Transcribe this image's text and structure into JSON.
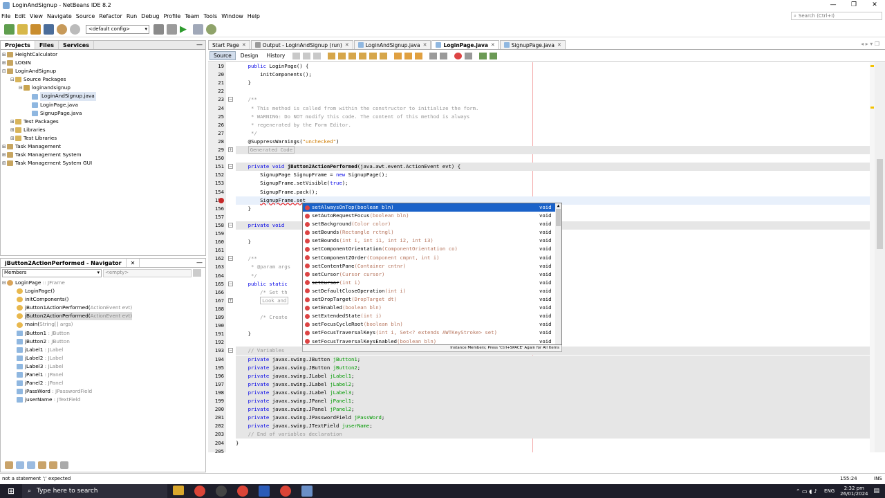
{
  "window": {
    "title": "LoginAndSignup - NetBeans IDE 8.2",
    "controls": [
      "—",
      "❐",
      "✕"
    ]
  },
  "menu": [
    "File",
    "Edit",
    "View",
    "Navigate",
    "Source",
    "Refactor",
    "Run",
    "Debug",
    "Profile",
    "Team",
    "Tools",
    "Window",
    "Help"
  ],
  "search": {
    "placeholder": "Search (Ctrl+I)"
  },
  "toolbar": {
    "config": "<default config>"
  },
  "projects_panel": {
    "tabs": [
      "Projects",
      "Files",
      "Services"
    ],
    "tree": [
      {
        "label": "HeightCalculator",
        "level": 0,
        "exp": "⊞",
        "icon": "project"
      },
      {
        "label": "LOGIN",
        "level": 0,
        "exp": "⊞",
        "icon": "project"
      },
      {
        "label": "LoginAndSignup",
        "level": 0,
        "exp": "⊟",
        "icon": "project"
      },
      {
        "label": "Source Packages",
        "level": 1,
        "exp": "⊟",
        "icon": "folder"
      },
      {
        "label": "loginandsignup",
        "level": 2,
        "exp": "⊟",
        "icon": "package"
      },
      {
        "label": "LoginAndSignup.java",
        "level": 3,
        "exp": "",
        "icon": "java",
        "selected": true
      },
      {
        "label": "LoginPage.java",
        "level": 3,
        "exp": "",
        "icon": "java"
      },
      {
        "label": "SignupPage.java",
        "level": 3,
        "exp": "",
        "icon": "java"
      },
      {
        "label": "Test Packages",
        "level": 1,
        "exp": "⊞",
        "icon": "folder"
      },
      {
        "label": "Libraries",
        "level": 1,
        "exp": "⊞",
        "icon": "folder"
      },
      {
        "label": "Test Libraries",
        "level": 1,
        "exp": "⊞",
        "icon": "folder"
      },
      {
        "label": "Task Management",
        "level": 0,
        "exp": "⊞",
        "icon": "project"
      },
      {
        "label": "Task Management System",
        "level": 0,
        "exp": "⊞",
        "icon": "project"
      },
      {
        "label": "Task Management System GUI",
        "level": 0,
        "exp": "⊞",
        "icon": "project"
      }
    ]
  },
  "navigator": {
    "title": "jButton2ActionPerformed - Navigator",
    "filter": "Members",
    "empty": "<empty>",
    "items": [
      {
        "name": "LoginPage",
        "type": " :: JFrame",
        "level": 0,
        "icon": "class"
      },
      {
        "name": "LoginPage()",
        "type": "",
        "level": 1,
        "icon": "ctor"
      },
      {
        "name": "initComponents()",
        "type": "",
        "level": 1,
        "icon": "method"
      },
      {
        "name": "jButton1ActionPerformed(",
        "type": "ActionEvent evt)",
        "level": 1,
        "icon": "method"
      },
      {
        "name": "jButton2ActionPerformed(",
        "type": "ActionEvent evt)",
        "level": 1,
        "icon": "method",
        "selected": true
      },
      {
        "name": "main(",
        "type": "String[] args)",
        "level": 1,
        "icon": "method"
      },
      {
        "name": "jButton1",
        "type": " : JButton",
        "level": 1,
        "icon": "field"
      },
      {
        "name": "jButton2",
        "type": " : JButton",
        "level": 1,
        "icon": "field"
      },
      {
        "name": "jLabel1",
        "type": " : JLabel",
        "level": 1,
        "icon": "field"
      },
      {
        "name": "jLabel2",
        "type": " : JLabel",
        "level": 1,
        "icon": "field"
      },
      {
        "name": "jLabel3",
        "type": " : JLabel",
        "level": 1,
        "icon": "field"
      },
      {
        "name": "jPanel1",
        "type": " : JPanel",
        "level": 1,
        "icon": "field"
      },
      {
        "name": "jPanel2",
        "type": " : JPanel",
        "level": 1,
        "icon": "field"
      },
      {
        "name": "jPassWord",
        "type": " : JPasswordField",
        "level": 1,
        "icon": "field"
      },
      {
        "name": "juserName",
        "type": " : JTextField",
        "level": 1,
        "icon": "field"
      }
    ]
  },
  "editor_tabs": [
    {
      "label": "Start Page",
      "active": false
    },
    {
      "label": "Output - LoginAndSignup (run)",
      "active": false
    },
    {
      "label": "LoginAndSignup.java",
      "active": false
    },
    {
      "label": "LoginPage.java",
      "active": true
    },
    {
      "label": "SignupPage.java",
      "active": false
    }
  ],
  "source_tabs": [
    "Source",
    "Design",
    "History"
  ],
  "code_lines": [
    {
      "n": "19",
      "html": "    <span class='kw'>public</span> LoginPage() {"
    },
    {
      "n": "20",
      "html": "        initComponents();"
    },
    {
      "n": "21",
      "html": "    }"
    },
    {
      "n": "22",
      "html": ""
    },
    {
      "n": "23",
      "html": "    <span class='cmt'>/**</span>"
    },
    {
      "n": "24",
      "html": "<span class='cmt'>     * This method is called from within the constructor to initialize the form.</span>"
    },
    {
      "n": "25",
      "html": "<span class='cmt'>     * WARNING: Do NOT modify this code. The content of this method is always</span>"
    },
    {
      "n": "26",
      "html": "<span class='cmt'>     * regenerated by the Form Editor.</span>"
    },
    {
      "n": "27",
      "html": "<span class='cmt'>     */</span>"
    },
    {
      "n": "28",
      "html": "    @SuppressWarnings(<span class='str'>\"unchecked\"</span>)"
    },
    {
      "n": "29",
      "html": "    <span class='cmt' style='border:1px solid #bbb;padding:0 2px'>Generated Code</span>",
      "shade": true
    },
    {
      "n": "150",
      "html": ""
    },
    {
      "n": "151",
      "html": "    <span class='kw'>private void</span> <span class='fn'>jButton2ActionPerformed</span>(java.awt.event.ActionEvent evt) {",
      "shade": true
    },
    {
      "n": "152",
      "html": "        SignupPage SignupFrame = <span class='kw'>new</span> SignupPage();"
    },
    {
      "n": "153",
      "html": "        SignupFrame.setVisible(<span class='kw'>true</span>);"
    },
    {
      "n": "154",
      "html": "        SignupFrame.pack();"
    },
    {
      "n": "155",
      "html": "        <span style='text-decoration:underline wavy #e00'>SignupFrame.set</span>",
      "hl": true
    },
    {
      "n": "156",
      "html": "    }"
    },
    {
      "n": "157",
      "html": ""
    },
    {
      "n": "158",
      "html": "    <span class='kw'>private void</span> ",
      "shade": true
    },
    {
      "n": "159",
      "html": ""
    },
    {
      "n": "160",
      "html": "    }"
    },
    {
      "n": "161",
      "html": ""
    },
    {
      "n": "162",
      "html": "    <span class='cmt'>/**</span>"
    },
    {
      "n": "163",
      "html": "<span class='cmt'>     * @param args</span>"
    },
    {
      "n": "164",
      "html": "<span class='cmt'>     */</span>"
    },
    {
      "n": "165",
      "html": "    <span class='kw'>public static</span>"
    },
    {
      "n": "166",
      "html": "        <span class='cmt'>/* Set th</span>"
    },
    {
      "n": "167",
      "html": "        <span class='cmt' style='border:1px solid #bbb;padding:0 2px'>Look and</span>"
    },
    {
      "n": "188",
      "html": ""
    },
    {
      "n": "189",
      "html": "        <span class='cmt'>/* Create</span>"
    },
    {
      "n": "190",
      "html": ""
    },
    {
      "n": "191",
      "html": "    }"
    },
    {
      "n": "192",
      "html": ""
    },
    {
      "n": "193",
      "html": "    <span class='cmt'>// Variables</span>",
      "shade": true
    },
    {
      "n": "194",
      "html": "    <span class='kw'>private</span> javax.swing.JButton <span class='var'>jButton1</span>;",
      "shade": true
    },
    {
      "n": "195",
      "html": "    <span class='kw'>private</span> javax.swing.JButton <span class='var'>jButton2</span>;",
      "shade": true
    },
    {
      "n": "196",
      "html": "    <span class='kw'>private</span> javax.swing.JLabel <span class='var'>jLabel1</span>;",
      "shade": true
    },
    {
      "n": "197",
      "html": "    <span class='kw'>private</span> javax.swing.JLabel <span class='var'>jLabel2</span>;",
      "shade": true
    },
    {
      "n": "198",
      "html": "    <span class='kw'>private</span> javax.swing.JLabel <span class='var'>jLabel3</span>;",
      "shade": true
    },
    {
      "n": "199",
      "html": "    <span class='kw'>private</span> javax.swing.JPanel <span class='var'>jPanel1</span>;",
      "shade": true
    },
    {
      "n": "200",
      "html": "    <span class='kw'>private</span> javax.swing.JPanel <span class='var'>jPanel2</span>;",
      "shade": true
    },
    {
      "n": "201",
      "html": "    <span class='kw'>private</span> javax.swing.JPasswordField <span class='var'>jPassWord</span>;",
      "shade": true
    },
    {
      "n": "202",
      "html": "    <span class='kw'>private</span> javax.swing.JTextField <span class='var'>juserName</span>;",
      "shade": true
    },
    {
      "n": "203",
      "html": "    <span class='cmt'>// End of variables declaration</span>",
      "shade": true
    },
    {
      "n": "204",
      "html": "}"
    },
    {
      "n": "205",
      "html": ""
    }
  ],
  "completion": {
    "items": [
      {
        "name": "setAlwaysOnTop",
        "params": "(boolean bln)",
        "ret": "void",
        "selected": true
      },
      {
        "name": "setAutoRequestFocus",
        "params": "(boolean bln)",
        "ret": "void"
      },
      {
        "name": "setBackground",
        "params": "(Color color)",
        "ret": "void"
      },
      {
        "name": "setBounds",
        "params": "(Rectangle rctngl)",
        "ret": "void"
      },
      {
        "name": "setBounds",
        "params": "(int i, int i1, int i2, int i3)",
        "ret": "void"
      },
      {
        "name": "setComponentOrientation",
        "params": "(ComponentOrientation co)",
        "ret": "void"
      },
      {
        "name": "setComponentZOrder",
        "params": "(Component cmpnt, int i)",
        "ret": "void"
      },
      {
        "name": "setContentPane",
        "params": "(Container cntnr)",
        "ret": "void"
      },
      {
        "name": "setCursor",
        "params": "(Cursor cursor)",
        "ret": "void"
      },
      {
        "name": "setCursor",
        "params": "(int i)",
        "ret": "void",
        "strike": true
      },
      {
        "name": "setDefaultCloseOperation",
        "params": "(int i)",
        "ret": "void"
      },
      {
        "name": "setDropTarget",
        "params": "(DropTarget dt)",
        "ret": "void"
      },
      {
        "name": "setEnabled",
        "params": "(boolean bln)",
        "ret": "void"
      },
      {
        "name": "setExtendedState",
        "params": "(int i)",
        "ret": "void"
      },
      {
        "name": "setFocusCycleRoot",
        "params": "(boolean bln)",
        "ret": "void"
      },
      {
        "name": "setFocusTraversalKeys",
        "params": "(int i, Set<? extends AWTKeyStroke> set)",
        "ret": "void"
      },
      {
        "name": "setFocusTraversalKeysEnabled",
        "params": "(boolean bln)",
        "ret": "void"
      }
    ],
    "footer": "Instance Members; Press 'Ctrl+SPACE' Again for All Items"
  },
  "status": {
    "message": "not a statement  ';' expected",
    "position": "155:24",
    "mode": "INS"
  },
  "taskbar": {
    "search_placeholder": "Type here to search",
    "language": "ENG",
    "time": "2:32 pm",
    "date": "26/01/2024"
  }
}
